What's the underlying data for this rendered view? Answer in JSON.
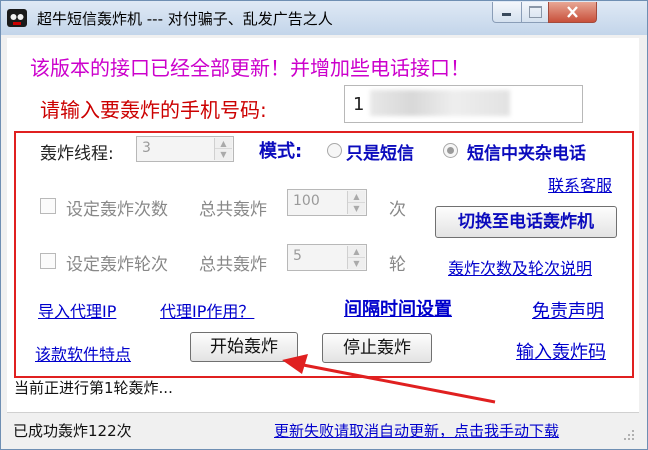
{
  "window": {
    "title": "超牛短信轰炸机 --- 对付骗子、乱发广告之人"
  },
  "notice": "该版本的接口已经全部更新！并增加些电话接口！",
  "phone": {
    "prompt": "请输入要轰炸的手机号码:",
    "value": "1"
  },
  "controls": {
    "threads_label": "轰炸线程:",
    "threads_value": "3",
    "mode_label": "模式:",
    "mode_sms_only": "只是短信",
    "mode_sms_with_calls": "短信中夹杂电话",
    "contact_support": "联系客服",
    "set_count_label": "设定轰炸次数",
    "total_label_1": "总共轰炸",
    "count_value": "100",
    "count_unit": "次",
    "switch_to_call_button": "切换至电话轰炸机",
    "set_rounds_label": "设定轰炸轮次",
    "total_label_2": "总共轰炸",
    "rounds_value": "5",
    "rounds_unit": "轮",
    "count_rounds_help": "轰炸次数及轮次说明",
    "import_proxy": "导入代理IP",
    "proxy_purpose": "代理IP作用？",
    "interval_settings": "间隔时间设置",
    "disclaimer": "免责声明",
    "software_features": "该款软件特点",
    "start_button": "开始轰炸",
    "stop_button": "停止轰炸",
    "input_code": "输入轰炸码"
  },
  "progress_text": "当前正进行第1轮轰炸...",
  "status": {
    "success_count": "已成功轰炸122次",
    "update_link": "更新失败请取消自动更新，点击我手动下载"
  },
  "colors": {
    "annotation_red": "#e02020",
    "notice_magenta": "#cc00cc",
    "prompt_red": "#cc0000",
    "link_blue": "#0000cc"
  }
}
